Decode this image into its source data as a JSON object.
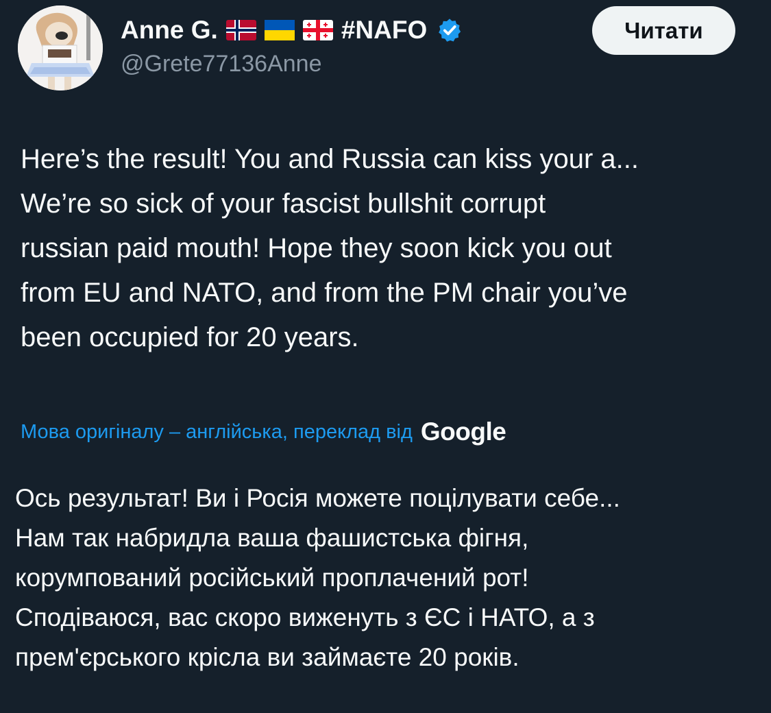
{
  "author": {
    "display_name": "Anne G.",
    "hashtag": "#NAFO",
    "handle": "@Grete77136Anne",
    "flag_icons": [
      "norway-flag-icon",
      "ukraine-flag-icon",
      "georgia-flag-icon"
    ],
    "verified_icon": "verified-badge-icon"
  },
  "follow_button": {
    "label": "Читати"
  },
  "tweet": {
    "lines": [
      "Here’s the result! You and Russia can kiss your a...",
      "We’re so sick of your fascist bullshit corrupt",
      "russian paid mouth! Hope they soon kick you out",
      "from EU and NATO, and from the PM chair you’ve",
      "been occupied for 20 years."
    ]
  },
  "translation": {
    "label": "Мова оригіналу – англійська, переклад від",
    "provider": "Google",
    "lines": [
      "Ось результат! Ви і Росія можете поцілувати себе...",
      "Нам так набридла ваша фашистська фігня,",
      "корумпований російський проплачений рот!",
      "Сподіваюся, вас скоро виженуть з ЄС і НАТО, а з",
      "прем'єрського крісла ви займаєте 20 років."
    ]
  },
  "colors": {
    "background": "#15202b",
    "text": "#f7f9f9",
    "secondary_text": "#8b98a5",
    "link": "#1d9bf0",
    "button_bg": "#eff3f4",
    "button_text": "#0f1419",
    "verified": "#1d9bf0"
  }
}
